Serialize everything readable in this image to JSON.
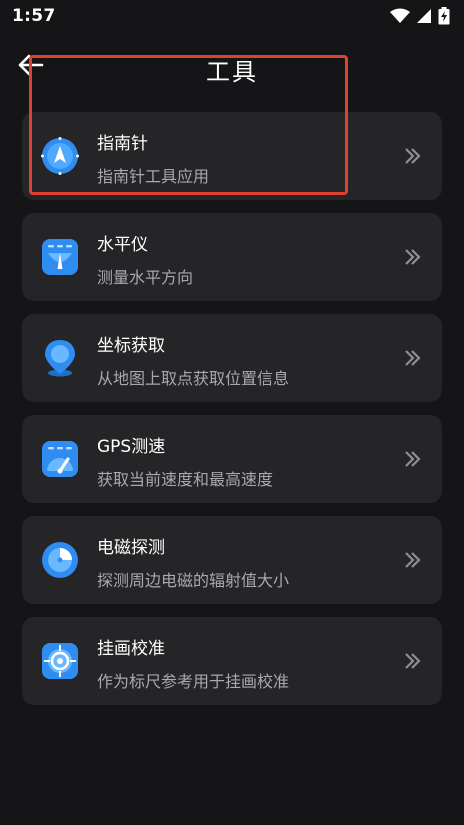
{
  "status_bar": {
    "time": "1:57",
    "icons": [
      "wifi-icon",
      "signal-icon",
      "battery-charging-icon"
    ]
  },
  "header": {
    "title": "工具",
    "back_icon": "back-arrow-icon"
  },
  "tools": [
    {
      "title": "指南针",
      "description": "指南针工具应用",
      "icon": "compass-icon"
    },
    {
      "title": "水平仪",
      "description": "测量水平方向",
      "icon": "level-icon"
    },
    {
      "title": "坐标获取",
      "description": "从地图上取点获取位置信息",
      "icon": "location-pin-icon"
    },
    {
      "title": "GPS测速",
      "description": "获取当前速度和最高速度",
      "icon": "speedometer-icon"
    },
    {
      "title": "电磁探测",
      "description": "探测周边电磁的辐射值大小",
      "icon": "radar-icon"
    },
    {
      "title": "挂画校准",
      "description": "作为标尺参考用于挂画校准",
      "icon": "target-icon"
    }
  ],
  "colors": {
    "background": "#151517",
    "card": "#252528",
    "accent_blue": "#2f8cf0",
    "highlight": "#e0402e",
    "secondary_text": "#a8a8ad"
  }
}
